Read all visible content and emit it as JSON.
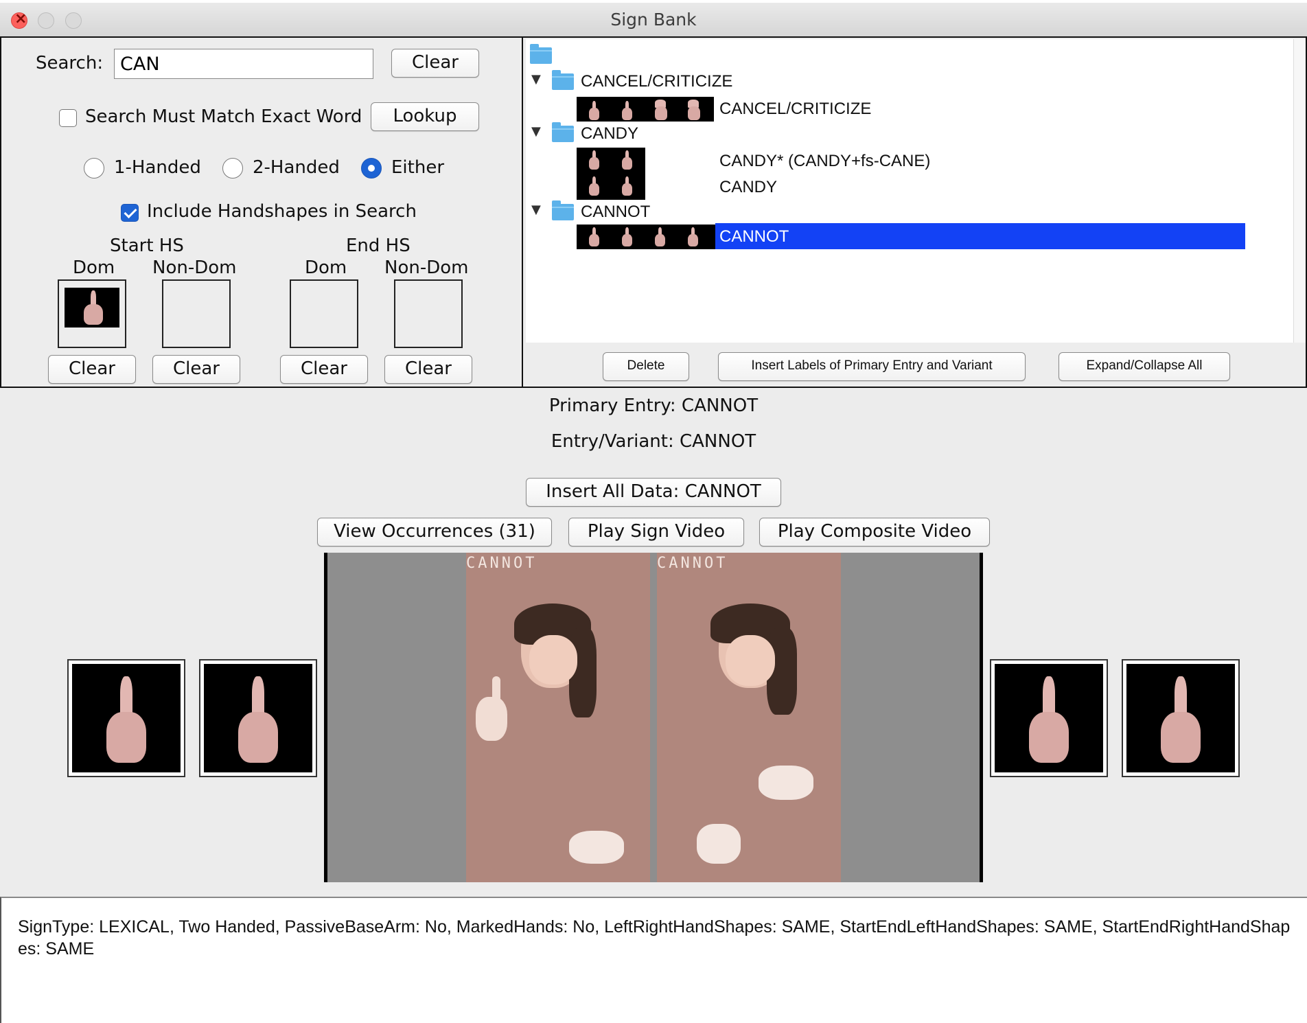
{
  "window": {
    "title": "Sign Bank"
  },
  "search": {
    "label": "Search:",
    "value": "CAN",
    "clear_label": "Clear",
    "exact_label": "Search Must Match Exact Word",
    "exact_checked": false,
    "lookup_label": "Lookup"
  },
  "hands": {
    "one": "1-Handed",
    "two": "2-Handed",
    "either": "Either",
    "selected": "Either"
  },
  "handshapes": {
    "include_label": "Include Handshapes in Search",
    "include_checked": true,
    "start_label": "Start HS",
    "end_label": "End HS",
    "dom_label": "Dom",
    "nondom_label": "Non-Dom",
    "clear_label": "Clear"
  },
  "tree": {
    "groups": [
      {
        "label": "CANCEL/CRITICIZE",
        "entries": [
          "CANCEL/CRITICIZE"
        ]
      },
      {
        "label": "CANDY",
        "entries": [
          "CANDY* (CANDY+fs-CANE)",
          "CANDY"
        ]
      },
      {
        "label": "CANNOT",
        "entries": [
          "CANNOT"
        ]
      }
    ],
    "selected": "CANNOT"
  },
  "tree_buttons": {
    "delete": "Delete",
    "insert_labels": "Insert Labels of Primary Entry and Variant",
    "expand_collapse": "Expand/Collapse All"
  },
  "entry": {
    "primary": "Primary Entry: CANNOT",
    "variant": "Entry/Variant: CANNOT",
    "insert_all": "Insert All Data: CANNOT",
    "view_occurrences": "View Occurrences (31)",
    "play_sign": "Play Sign Video",
    "play_composite": "Play Composite Video"
  },
  "video": {
    "caption_left": "CANNOT",
    "caption_right": "CANNOT"
  },
  "info": {
    "text": "SignType: LEXICAL, Two Handed, PassiveBaseArm: No, MarkedHands: No, LeftRightHandShapes: SAME, StartEndLeftHandShapes: SAME, StartEndRightHandShapes: SAME"
  },
  "colors": {
    "selection": "#1342f5",
    "accent": "#1e64d4",
    "folder": "#5cb2ea"
  }
}
